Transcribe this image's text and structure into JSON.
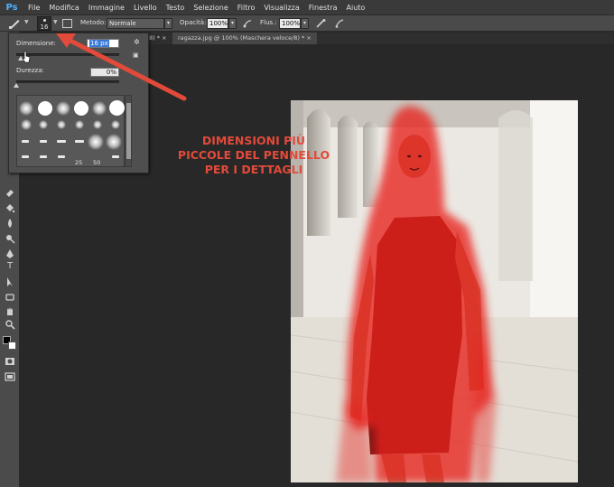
{
  "app": {
    "logo": "Ps"
  },
  "menu": [
    "File",
    "Modifica",
    "Immagine",
    "Livello",
    "Testo",
    "Selezione",
    "Filtro",
    "Visualizza",
    "Finestra",
    "Aiuto"
  ],
  "options_bar": {
    "brush_size": "16",
    "method_label": "Metodo:",
    "method_value": "Normale",
    "opacity_label": "Opacità:",
    "opacity_value": "100%",
    "flow_label": "Flus.:",
    "flow_value": "100%"
  },
  "tabs": [
    {
      "label": "8) *",
      "close": "×"
    },
    {
      "label": "ragazza.jpg @ 100% (Maschera veloce/8) *",
      "close": "×"
    }
  ],
  "brush_popup": {
    "size_label": "Dimensione:",
    "size_value": "16 px",
    "hardness_label": "Durezza:",
    "hardness_value": "0%",
    "size_slider": 0.04,
    "hardness_slider": 0.0,
    "preset_numbers": [
      "25",
      "50"
    ]
  },
  "annotation": {
    "lines": [
      "DIMENSIONI PIÙ",
      "PICCOLE DEL PENNELLO",
      "PER I DETTAGLI"
    ],
    "color": "#e24a3a"
  },
  "mask_color": "#e8201c",
  "icons": {
    "brush_tool": "brush-icon",
    "panel_toggle": "brush-panel-icon",
    "airbrush": "airbrush-icon",
    "pressure": "pressure-icon",
    "gear": "gear-icon",
    "new_preset": "new-preset-icon"
  }
}
